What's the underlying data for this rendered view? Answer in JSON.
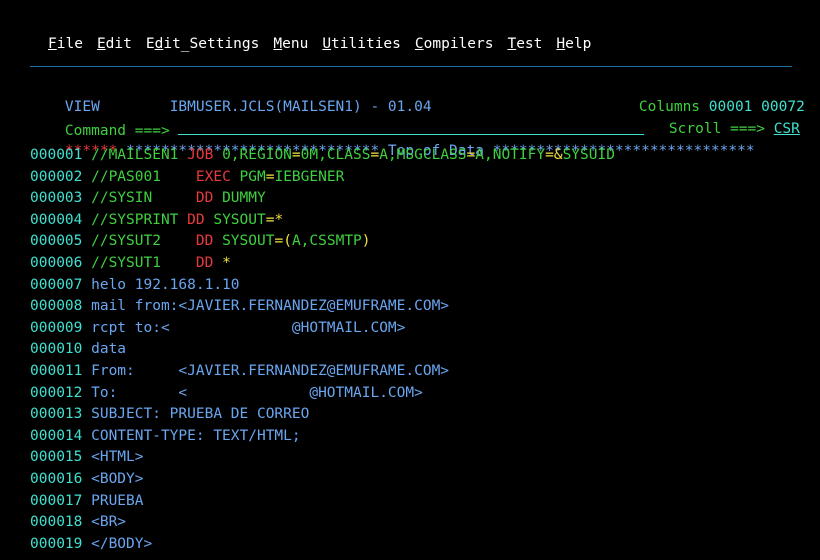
{
  "menu": {
    "items": [
      {
        "hot": "F",
        "rest": "ile"
      },
      {
        "hot": "E",
        "rest": "dit"
      },
      {
        "hot": "",
        "pre": "E",
        "hot2": "d",
        "rest": "it_Settings"
      },
      {
        "hot": "M",
        "rest": "enu"
      },
      {
        "hot": "U",
        "rest": "tilities"
      },
      {
        "hot": "C",
        "rest": "ompilers"
      },
      {
        "hot": "T",
        "rest": "est"
      },
      {
        "hot": "H",
        "rest": "elp"
      }
    ]
  },
  "header": {
    "mode": "VIEW",
    "dataset": "IBMUSER.JCLS(MAILSEN1) - 01.04",
    "columns_label": "Columns",
    "columns_from": "00001",
    "columns_to": "00072"
  },
  "command": {
    "label": "Command ===>",
    "value": "",
    "scroll_label": "Scroll ===>",
    "scroll_value": "CSR"
  },
  "top_of_data": {
    "prefix": "******",
    "text": " ***************************** Top of Data ******************************"
  },
  "lines": [
    {
      "num": "000001",
      "parts": [
        [
          "green",
          "//MAILSEN1 "
        ],
        [
          "red",
          "JOB "
        ],
        [
          "green",
          "0,REGION"
        ],
        [
          "yellow",
          "="
        ],
        [
          "green",
          "0M,CLASS"
        ],
        [
          "yellow",
          "="
        ],
        [
          "green",
          "A,MSGCLASS"
        ],
        [
          "yellow",
          "="
        ],
        [
          "green",
          "A,NOTIFY"
        ],
        [
          "yellow",
          "="
        ],
        [
          "yellow",
          "&"
        ],
        [
          "green",
          "SYSUID"
        ]
      ]
    },
    {
      "num": "000002",
      "parts": [
        [
          "green",
          "//PAS001    "
        ],
        [
          "red",
          "EXEC "
        ],
        [
          "green",
          "PGM"
        ],
        [
          "yellow",
          "="
        ],
        [
          "green",
          "IEBGENER"
        ]
      ]
    },
    {
      "num": "000003",
      "parts": [
        [
          "green",
          "//SYSIN     "
        ],
        [
          "red",
          "DD "
        ],
        [
          "green",
          "DUMMY"
        ]
      ]
    },
    {
      "num": "000004",
      "parts": [
        [
          "green",
          "//SYSPRINT "
        ],
        [
          "red",
          "DD "
        ],
        [
          "green",
          "SYSOUT"
        ],
        [
          "yellow",
          "=*"
        ]
      ]
    },
    {
      "num": "000005",
      "parts": [
        [
          "green",
          "//SYSUT2    "
        ],
        [
          "red",
          "DD "
        ],
        [
          "green",
          "SYSOUT"
        ],
        [
          "yellow",
          "=("
        ],
        [
          "green",
          "A,CSSMTP"
        ],
        [
          "yellow",
          ")"
        ]
      ]
    },
    {
      "num": "000006",
      "parts": [
        [
          "green",
          "//SYSUT1    "
        ],
        [
          "red",
          "DD "
        ],
        [
          "yellow",
          "*"
        ]
      ]
    },
    {
      "num": "000007",
      "parts": [
        [
          "blue",
          "helo 192.168.1.10"
        ]
      ]
    },
    {
      "num": "000008",
      "parts": [
        [
          "blue",
          "mail from:<JAVIER.FERNANDEZ@EMUFRAME.COM>"
        ]
      ]
    },
    {
      "num": "000009",
      "parts": [
        [
          "blue",
          "rcpt to:<              @HOTMAIL.COM>"
        ]
      ]
    },
    {
      "num": "000010",
      "parts": [
        [
          "blue",
          "data"
        ]
      ]
    },
    {
      "num": "000011",
      "parts": [
        [
          "blue",
          "From:     <JAVIER.FERNANDEZ@EMUFRAME.COM>"
        ]
      ]
    },
    {
      "num": "000012",
      "parts": [
        [
          "blue",
          "To:       <              @HOTMAIL.COM>"
        ]
      ]
    },
    {
      "num": "000013",
      "parts": [
        [
          "blue",
          "SUBJECT: PRUEBA DE CORREO"
        ]
      ]
    },
    {
      "num": "000014",
      "parts": [
        [
          "blue",
          "CONTENT-TYPE: TEXT/HTML;"
        ]
      ]
    },
    {
      "num": "000015",
      "parts": [
        [
          "blue",
          "<HTML>"
        ]
      ]
    },
    {
      "num": "000016",
      "parts": [
        [
          "blue",
          "<BODY>"
        ]
      ]
    },
    {
      "num": "000017",
      "parts": [
        [
          "blue",
          "PRUEBA"
        ]
      ]
    },
    {
      "num": "000018",
      "parts": [
        [
          "blue",
          "<BR>"
        ]
      ]
    },
    {
      "num": "000019",
      "parts": [
        [
          "blue",
          "</BODY>"
        ]
      ]
    }
  ]
}
